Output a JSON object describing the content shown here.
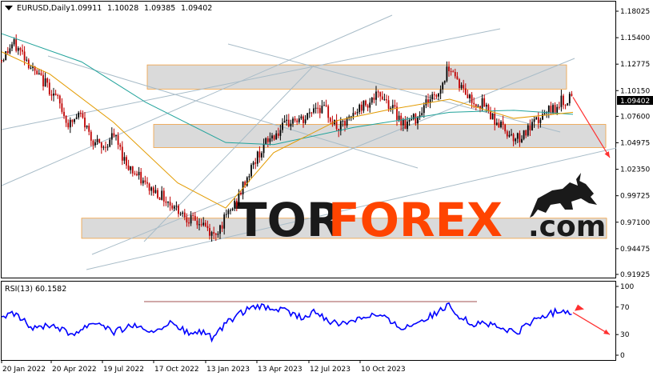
{
  "chart_data": [
    {
      "type": "line",
      "symbol": "EURUSD,Daily",
      "ohlc": [
        "1.09911",
        "1.10028",
        "1.09385",
        "1.09402"
      ],
      "last_price": "1.09402",
      "ylim": [
        0.91925,
        1.18025
      ],
      "y_ticks": [
        "1.18025",
        "1.15400",
        "1.12775",
        "1.10150",
        "1.07600",
        "1.04975",
        "1.02350",
        "0.99725",
        "0.97100",
        "0.94475",
        "0.91925"
      ],
      "x_ticks": [
        "20 Jan 2022",
        "20 Apr 2022",
        "19 Jul 2022",
        "17 Oct 2022",
        "13 Jan 2023",
        "13 Apr 2023",
        "12 Jul 2023",
        "10 Oct 2023"
      ],
      "price_path": [
        [
          0,
          1.132
        ],
        [
          14,
          1.148
        ],
        [
          28,
          1.137
        ],
        [
          42,
          1.118
        ],
        [
          56,
          1.108
        ],
        [
          70,
          1.092
        ],
        [
          84,
          1.067
        ],
        [
          98,
          1.078
        ],
        [
          112,
          1.055
        ],
        [
          126,
          1.043
        ],
        [
          140,
          1.058
        ],
        [
          154,
          1.032
        ],
        [
          168,
          1.018
        ],
        [
          182,
          1.006
        ],
        [
          196,
          1.0
        ],
        [
          210,
          0.99
        ],
        [
          224,
          0.982
        ],
        [
          238,
          0.972
        ],
        [
          252,
          0.969
        ],
        [
          264,
          0.957
        ],
        [
          280,
          0.975
        ],
        [
          294,
          0.992
        ],
        [
          308,
          1.018
        ],
        [
          322,
          1.04
        ],
        [
          336,
          1.055
        ],
        [
          350,
          1.063
        ],
        [
          364,
          1.073
        ],
        [
          378,
          1.071
        ],
        [
          392,
          1.087
        ],
        [
          406,
          1.081
        ],
        [
          420,
          1.063
        ],
        [
          434,
          1.072
        ],
        [
          448,
          1.085
        ],
        [
          462,
          1.093
        ],
        [
          476,
          1.097
        ],
        [
          490,
          1.082
        ],
        [
          504,
          1.068
        ],
        [
          518,
          1.075
        ],
        [
          532,
          1.092
        ],
        [
          546,
          1.099
        ],
        [
          560,
          1.128
        ],
        [
          574,
          1.105
        ],
        [
          588,
          1.091
        ],
        [
          602,
          1.088
        ],
        [
          616,
          1.073
        ],
        [
          630,
          1.062
        ],
        [
          644,
          1.054
        ],
        [
          658,
          1.062
        ],
        [
          672,
          1.073
        ],
        [
          686,
          1.082
        ],
        [
          700,
          1.091
        ],
        [
          714,
          1.094
        ]
      ],
      "ma_fast": [
        [
          0,
          1.14
        ],
        [
          60,
          1.118
        ],
        [
          140,
          1.07
        ],
        [
          220,
          1.01
        ],
        [
          280,
          0.985
        ],
        [
          340,
          1.04
        ],
        [
          420,
          1.072
        ],
        [
          480,
          1.082
        ],
        [
          560,
          1.093
        ],
        [
          640,
          1.074
        ],
        [
          714,
          1.08
        ]
      ],
      "ma_slow": [
        [
          0,
          1.158
        ],
        [
          100,
          1.13
        ],
        [
          180,
          1.09
        ],
        [
          280,
          1.05
        ],
        [
          340,
          1.048
        ],
        [
          440,
          1.065
        ],
        [
          560,
          1.08
        ],
        [
          640,
          1.082
        ],
        [
          714,
          1.078
        ]
      ],
      "price_zones": [
        [
          1.103,
          1.127
        ],
        [
          1.045,
          1.068
        ],
        [
          0.955,
          0.975
        ]
      ],
      "forecast_arrow": [
        [
          714,
          1.095
        ],
        [
          760,
          1.035
        ]
      ]
    },
    {
      "type": "line",
      "title": "RSI(13) 60.1582",
      "ylim": [
        0,
        100
      ],
      "y_ticks": [
        "100",
        "70",
        "30",
        "0"
      ],
      "path": [
        [
          0,
          52
        ],
        [
          14,
          60
        ],
        [
          28,
          49
        ],
        [
          42,
          38
        ],
        [
          56,
          45
        ],
        [
          70,
          42
        ],
        [
          84,
          31
        ],
        [
          98,
          36
        ],
        [
          112,
          48
        ],
        [
          126,
          46
        ],
        [
          140,
          33
        ],
        [
          154,
          40
        ],
        [
          168,
          45
        ],
        [
          182,
          30
        ],
        [
          196,
          40
        ],
        [
          210,
          46
        ],
        [
          224,
          38
        ],
        [
          238,
          30
        ],
        [
          252,
          35
        ],
        [
          264,
          23
        ],
        [
          280,
          45
        ],
        [
          294,
          58
        ],
        [
          308,
          66
        ],
        [
          322,
          70
        ],
        [
          336,
          68
        ],
        [
          350,
          66
        ],
        [
          364,
          60
        ],
        [
          378,
          53
        ],
        [
          392,
          63
        ],
        [
          406,
          53
        ],
        [
          420,
          44
        ],
        [
          434,
          50
        ],
        [
          448,
          55
        ],
        [
          462,
          59
        ],
        [
          476,
          57
        ],
        [
          490,
          45
        ],
        [
          504,
          40
        ],
        [
          518,
          48
        ],
        [
          532,
          55
        ],
        [
          546,
          62
        ],
        [
          560,
          73
        ],
        [
          574,
          55
        ],
        [
          588,
          45
        ],
        [
          602,
          48
        ],
        [
          616,
          42
        ],
        [
          630,
          36
        ],
        [
          644,
          33
        ],
        [
          658,
          45
        ],
        [
          672,
          55
        ],
        [
          686,
          60
        ],
        [
          700,
          66
        ],
        [
          714,
          62
        ]
      ],
      "reference_level": 72,
      "forecast_arrow": [
        [
          714,
          62
        ],
        [
          760,
          30
        ]
      ]
    }
  ],
  "watermark": {
    "part1": "TOR",
    "part2": "FOREX",
    "part3": ".com"
  },
  "colors": {
    "bull": "#000000",
    "bear": "#c00000",
    "ma_fast": "#e39b00",
    "ma_slow": "#21a39b",
    "rsi": "#0000ff",
    "zone": "#dadada",
    "zone_border": "#f0a040",
    "arrow": "#ff3030",
    "trend": "#a8bcc8",
    "wm_dark": "#1a1a1a",
    "wm_orange": "#ff4400"
  }
}
